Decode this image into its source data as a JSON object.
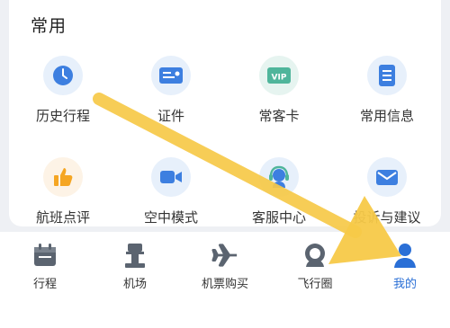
{
  "section": {
    "title": "常用"
  },
  "grid": {
    "rows": [
      [
        {
          "label": "历史行程",
          "icon": "clock-icon"
        },
        {
          "label": "证件",
          "icon": "id-card-icon"
        },
        {
          "label": "常客卡",
          "icon": "vip-card-icon"
        },
        {
          "label": "常用信息",
          "icon": "document-icon"
        }
      ],
      [
        {
          "label": "航班点评",
          "icon": "thumbs-up-icon"
        },
        {
          "label": "空中模式",
          "icon": "video-camera-icon"
        },
        {
          "label": "客服中心",
          "icon": "customer-service-icon"
        },
        {
          "label": "投诉与建议",
          "icon": "mail-icon"
        }
      ]
    ]
  },
  "tabbar": {
    "tabs": [
      {
        "label": "行程",
        "icon": "calendar-icon",
        "active": false
      },
      {
        "label": "机场",
        "icon": "airport-tower-icon",
        "active": false
      },
      {
        "label": "机票购买",
        "icon": "airplane-icon",
        "active": false
      },
      {
        "label": "飞行圈",
        "icon": "community-icon",
        "active": false
      },
      {
        "label": "我的",
        "icon": "profile-icon",
        "active": true
      }
    ]
  },
  "colors": {
    "accent_blue": "#2a6fd6",
    "icon_blue": "#3d7fe0",
    "icon_green": "#4fb59b",
    "icon_orange": "#f5a623",
    "tab_icon_gray": "#5b6470",
    "annotation_arrow": "#f7c948"
  }
}
